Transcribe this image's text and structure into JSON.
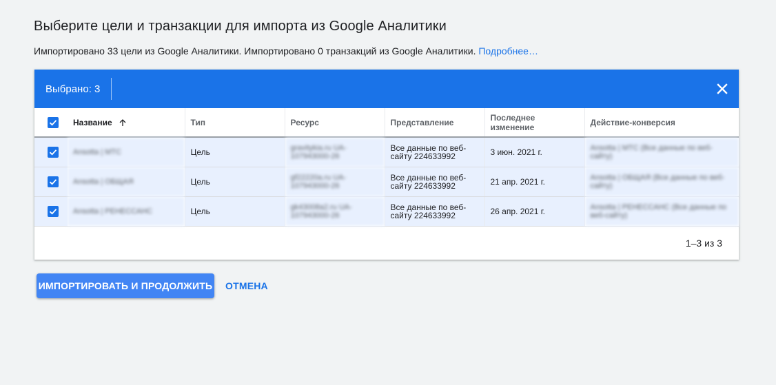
{
  "header": {
    "title": "Выберите цели и транзакции для импорта из Google Аналитики",
    "subtitle": "Импортировано 33 цели из Google Аналитики. Импортировано 0 транзакций из Google Аналитики.",
    "learn_more": "Подробнее…"
  },
  "selection": {
    "label": "Выбрано: 3"
  },
  "table": {
    "columns": [
      "Название",
      "Тип",
      "Ресурс",
      "Представление",
      "Последнее изменение",
      "Действие-конверсия"
    ],
    "rows": [
      {
        "name": "Ansotta | MTC",
        "type": "Цель",
        "resource": "gravitykia.ru UA-107943000-26",
        "view": "Все данные по веб-сайту 224633992",
        "modified": "3 июн. 2021 г.",
        "conversion": "Ansotta | MTC (Все данные по веб-сайту)"
      },
      {
        "name": "Ansotta | ОБЩАЯ",
        "type": "Цель",
        "resource": "gf22220a.ru UA-107943000-26",
        "view": "Все данные по веб-сайту 224633992",
        "modified": "21 апр. 2021 г.",
        "conversion": "Ansotta | ОБЩАЯ (Все данные по веб-сайту)"
      },
      {
        "name": "Ansotta | РЕНЕССАНС",
        "type": "Цель",
        "resource": "gk43008a2.ru UA-107943000-26",
        "view": "Все данные по веб-сайту 224633992",
        "modified": "26 апр. 2021 г.",
        "conversion": "Ansotta | РЕНЕССАНС (Все данные по веб-сайту)"
      }
    ]
  },
  "pagination": "1–3 из 3",
  "actions": {
    "import": "ИМПОРТИРОВАТЬ И ПРОДОЛЖИТЬ",
    "cancel": "ОТМЕНА"
  },
  "colors": {
    "accent": "#1a73e8",
    "row_selected": "#e8f0fe",
    "primary_button": "#4285f4"
  }
}
